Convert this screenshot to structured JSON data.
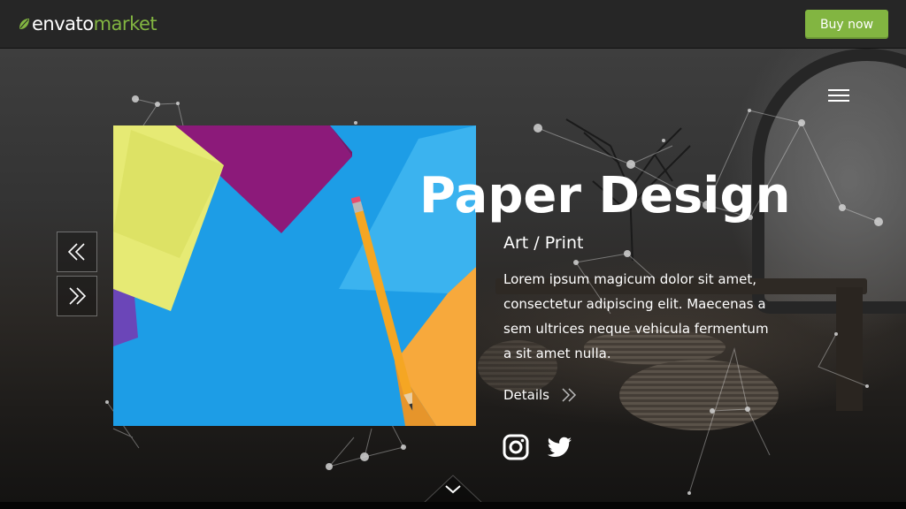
{
  "header": {
    "logo_part1": "envato",
    "logo_part2": "market",
    "buy_label": "Buy now"
  },
  "slide": {
    "title": "Paper Design",
    "subtitle": "Art / Print",
    "description": "Lorem ipsum magicum dolor sit amet, consectetur adipiscing elit. Maecenas a sem ultrices neque vehicula fermentum a sit amet nulla.",
    "details_label": "Details"
  },
  "colors": {
    "accent": "#82b541",
    "topbar": "#262626",
    "card_blue": "#1fa0e8"
  },
  "icons": [
    "leaf-icon",
    "menu-icon",
    "prev-arrow-icon",
    "next-arrow-icon",
    "details-arrow-icon",
    "instagram-icon",
    "twitter-icon",
    "chevron-down-icon"
  ]
}
